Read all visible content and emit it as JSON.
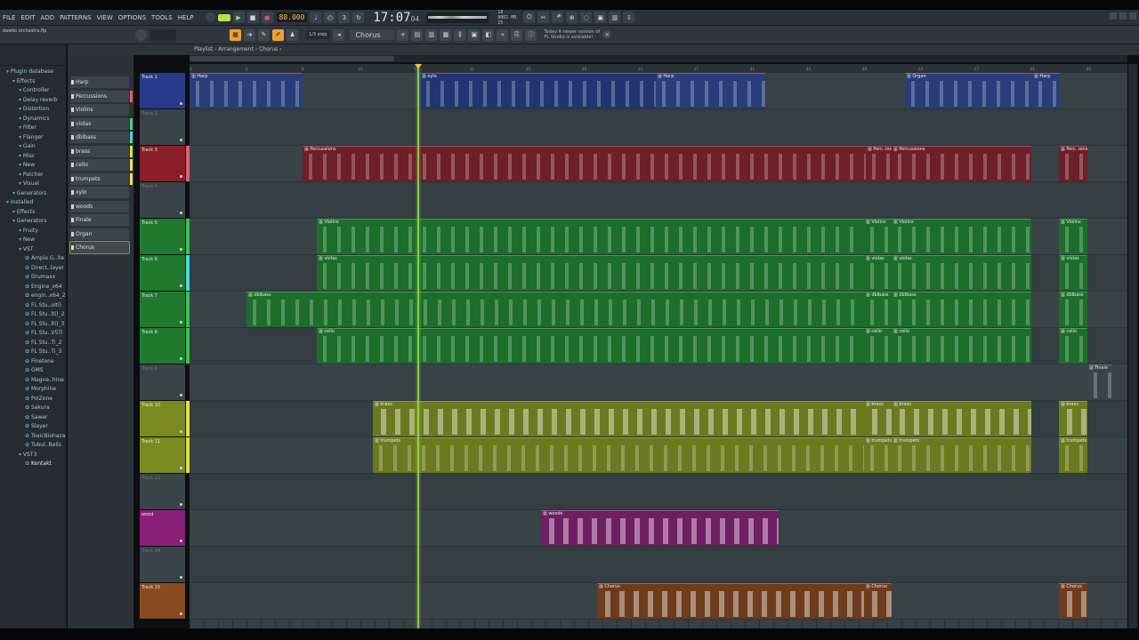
{
  "menu": [
    "FILE",
    "EDIT",
    "ADD",
    "PATTERNS",
    "VIEW",
    "OPTIONS",
    "TOOLS",
    "HELP"
  ],
  "transport": {
    "tempo": "88.000",
    "time_main": "17:07",
    "time_sub": "04",
    "cpu_line1": "9061 MB",
    "cpu_line2": "15",
    "cpu_line3": "18"
  },
  "project_name": "dawko orchestra.flp",
  "toolbar2": {
    "snap": "1/3 step",
    "pattern": "Chorus",
    "news_line1": "Today  A newer version of",
    "news_line2": "FL Studio is available!"
  },
  "playlist": {
    "title": "Playlist - Arrangement › Chorus ›"
  },
  "browser": {
    "items": [
      {
        "label": "Plugin database",
        "indent": 1
      },
      {
        "label": "Effects",
        "indent": 2
      },
      {
        "label": "Controller",
        "indent": 3
      },
      {
        "label": "Delay reverb",
        "indent": 3
      },
      {
        "label": "Distortion",
        "indent": 3
      },
      {
        "label": "Dynamics",
        "indent": 3
      },
      {
        "label": "Filter",
        "indent": 3
      },
      {
        "label": "Flanger",
        "indent": 3
      },
      {
        "label": "Gain",
        "indent": 3
      },
      {
        "label": "Misc",
        "indent": 3
      },
      {
        "label": "New",
        "indent": 3
      },
      {
        "label": "Patcher",
        "indent": 3
      },
      {
        "label": "Visual",
        "indent": 3
      },
      {
        "label": "Generators",
        "indent": 2
      },
      {
        "label": "Installed",
        "indent": 1
      },
      {
        "label": "Effects",
        "indent": 2
      },
      {
        "label": "Generators",
        "indent": 2
      },
      {
        "label": "Fruity",
        "indent": 3
      },
      {
        "label": "New",
        "indent": 3
      },
      {
        "label": "VST",
        "indent": 3
      },
      {
        "label": "Ample G..ite",
        "indent": 4
      },
      {
        "label": "Direct..layer",
        "indent": 4
      },
      {
        "label": "Drumaxx",
        "indent": 4
      },
      {
        "label": "Engine_x64",
        "indent": 4
      },
      {
        "label": "engin..x64_2",
        "indent": 4
      },
      {
        "label": "FL Stu..olti)",
        "indent": 4
      },
      {
        "label": "FL Stu..lti)_2",
        "indent": 4
      },
      {
        "label": "FL Stu..lti)_3",
        "indent": 4
      },
      {
        "label": "FL Stu..VSTi",
        "indent": 4
      },
      {
        "label": "FL Stu..Ti_2",
        "indent": 4
      },
      {
        "label": "FL Stu..Ti_3",
        "indent": 4
      },
      {
        "label": "Finetone",
        "indent": 4
      },
      {
        "label": "GMS",
        "indent": 4
      },
      {
        "label": "Magne..hine",
        "indent": 4
      },
      {
        "label": "Morphine",
        "indent": 4
      },
      {
        "label": "PoiZone",
        "indent": 4
      },
      {
        "label": "Sakura",
        "indent": 4
      },
      {
        "label": "Sawer",
        "indent": 4
      },
      {
        "label": "Slayer",
        "indent": 4
      },
      {
        "label": "ToxicBiohazard",
        "indent": 4
      },
      {
        "label": "Tubul..Bells",
        "indent": 4
      },
      {
        "label": "VST3",
        "indent": 3
      },
      {
        "label": "Kontakt",
        "indent": 4
      }
    ]
  },
  "picker": {
    "items": [
      {
        "label": "Harp",
        "color": ""
      },
      {
        "label": "Percussions",
        "color": "#e06070"
      },
      {
        "label": "Violins",
        "color": ""
      },
      {
        "label": "violas",
        "color": "#50d070"
      },
      {
        "label": "dblbass",
        "color": "#50d0d0"
      },
      {
        "label": "brass",
        "color": "#e0e040"
      },
      {
        "label": "cello",
        "color": "#f0e050"
      },
      {
        "label": "trumpets",
        "color": "#f0e050"
      },
      {
        "label": "xylo",
        "color": ""
      },
      {
        "label": "woods",
        "color": ""
      },
      {
        "label": "Finale",
        "color": ""
      },
      {
        "label": "Organ",
        "color": ""
      },
      {
        "label": "Chorus",
        "color": ""
      }
    ]
  },
  "tracks": [
    {
      "name": "Track 1",
      "color": "#2a3a8a",
      "bar": ""
    },
    {
      "name": "Track 2",
      "color": "",
      "bar": ""
    },
    {
      "name": "Track 3",
      "color": "#8a1f2a",
      "bar": "#e06070"
    },
    {
      "name": "Track 4",
      "color": "",
      "bar": ""
    },
    {
      "name": "Track 5",
      "color": "#1f7a2f",
      "bar": "#40c050"
    },
    {
      "name": "Track 6",
      "color": "#1f7a2f",
      "bar": "#40e0e0"
    },
    {
      "name": "Track 7",
      "color": "#1f7a2f",
      "bar": "#40c050"
    },
    {
      "name": "Track 8",
      "color": "#1f7a2f",
      "bar": "#40c050"
    },
    {
      "name": "Track 9",
      "color": "",
      "bar": ""
    },
    {
      "name": "Track 10",
      "color": "#7a8a1f",
      "bar": "#e0e040"
    },
    {
      "name": "Track 11",
      "color": "#7a8a1f",
      "bar": "#e0e040"
    },
    {
      "name": "Track 12",
      "color": "",
      "bar": ""
    },
    {
      "name": "wood",
      "color": "#8a1f7a",
      "bar": ""
    },
    {
      "name": "Track 14",
      "color": "",
      "bar": ""
    },
    {
      "name": "Track 15",
      "color": "#8a4a1f",
      "bar": ""
    }
  ],
  "ruler": [
    "1",
    "5",
    "9",
    "13",
    "17",
    "21",
    "25",
    "29",
    "33",
    "37",
    "41",
    "45",
    "49",
    "53",
    "57",
    "61",
    "65"
  ],
  "clips": [
    {
      "track": 0,
      "label": "Harp",
      "start": 0,
      "end": 127,
      "color": "#2a3d7a"
    },
    {
      "track": 0,
      "label": "xylo",
      "start": 259,
      "end": 647,
      "color": "#223572"
    },
    {
      "track": 0,
      "label": "Harp",
      "start": 524,
      "end": 647,
      "color": "#2a3d7a"
    },
    {
      "track": 0,
      "label": "Organ",
      "start": 804,
      "end": 947,
      "color": "#2a3d7a"
    },
    {
      "track": 0,
      "label": "Harp",
      "start": 947,
      "end": 978,
      "color": "#2a3d7a"
    },
    {
      "track": 2,
      "label": "Percussions",
      "start": 127,
      "end": 760,
      "color": "#6e1f29"
    },
    {
      "track": 2,
      "label": "Perc..ions",
      "start": 760,
      "end": 789,
      "color": "#6e1f29"
    },
    {
      "track": 2,
      "label": "Percussions",
      "start": 789,
      "end": 946,
      "color": "#6e1f29"
    },
    {
      "track": 2,
      "label": "Perc..ions",
      "start": 977,
      "end": 1009,
      "color": "#6e1f29"
    },
    {
      "track": 4,
      "label": "Violins",
      "start": 143,
      "end": 758,
      "color": "#1c6e2b"
    },
    {
      "track": 4,
      "label": "Violins",
      "start": 758,
      "end": 789,
      "color": "#1c6e2b"
    },
    {
      "track": 4,
      "label": "Violins",
      "start": 789,
      "end": 946,
      "color": "#1c6e2b"
    },
    {
      "track": 4,
      "label": "Violins",
      "start": 977,
      "end": 1009,
      "color": "#1c6e2b"
    },
    {
      "track": 5,
      "label": "violas",
      "start": 143,
      "end": 758,
      "color": "#1c6e2b"
    },
    {
      "track": 5,
      "label": "violas",
      "start": 758,
      "end": 789,
      "color": "#1c6e2b"
    },
    {
      "track": 5,
      "label": "violas",
      "start": 789,
      "end": 946,
      "color": "#1c6e2b"
    },
    {
      "track": 5,
      "label": "violas",
      "start": 977,
      "end": 1009,
      "color": "#1c6e2b"
    },
    {
      "track": 6,
      "label": "dblbass",
      "start": 64,
      "end": 758,
      "color": "#1c6e2b"
    },
    {
      "track": 6,
      "label": "dblbass",
      "start": 758,
      "end": 789,
      "color": "#1c6e2b"
    },
    {
      "track": 6,
      "label": "dblbass",
      "start": 789,
      "end": 946,
      "color": "#1c6e2b"
    },
    {
      "track": 6,
      "label": "dblbass",
      "start": 977,
      "end": 1009,
      "color": "#1c6e2b"
    },
    {
      "track": 7,
      "label": "cello",
      "start": 143,
      "end": 758,
      "color": "#1c6e2b"
    },
    {
      "track": 7,
      "label": "cello",
      "start": 758,
      "end": 789,
      "color": "#1c6e2b"
    },
    {
      "track": 7,
      "label": "cello",
      "start": 789,
      "end": 946,
      "color": "#1c6e2b"
    },
    {
      "track": 7,
      "label": "cello",
      "start": 977,
      "end": 1009,
      "color": "#1c6e2b"
    },
    {
      "track": 8,
      "label": "Finale",
      "start": 1009,
      "end": 1037,
      "color": "#3a4349"
    },
    {
      "track": 9,
      "label": "brass",
      "start": 206,
      "end": 758,
      "color": "#6b7a1e"
    },
    {
      "track": 9,
      "label": "brass",
      "start": 758,
      "end": 789,
      "color": "#6b7a1e"
    },
    {
      "track": 9,
      "label": "brass",
      "start": 789,
      "end": 946,
      "color": "#6b7a1e"
    },
    {
      "track": 9,
      "label": "brass",
      "start": 977,
      "end": 1009,
      "color": "#6b7a1e"
    },
    {
      "track": 10,
      "label": "trumpets",
      "start": 206,
      "end": 758,
      "color": "#6b7a1e"
    },
    {
      "track": 10,
      "label": "trumpets",
      "start": 758,
      "end": 789,
      "color": "#6b7a1e"
    },
    {
      "track": 10,
      "label": "trumpets",
      "start": 789,
      "end": 946,
      "color": "#6b7a1e"
    },
    {
      "track": 10,
      "label": "trumpets",
      "start": 977,
      "end": 1009,
      "color": "#6b7a1e"
    },
    {
      "track": 12,
      "label": "woods",
      "start": 395,
      "end": 662,
      "color": "#6e1f63"
    },
    {
      "track": 14,
      "label": "Chorus",
      "start": 458,
      "end": 758,
      "color": "#6e3b1c"
    },
    {
      "track": 14,
      "label": "Chorus",
      "start": 758,
      "end": 789,
      "color": "#6e3b1c"
    },
    {
      "track": 14,
      "label": "Chorus",
      "start": 977,
      "end": 1009,
      "color": "#6e3b1c"
    }
  ]
}
